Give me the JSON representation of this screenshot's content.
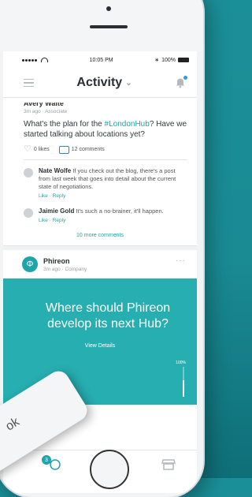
{
  "status_bar": {
    "time": "10:05 PM",
    "battery": "100%"
  },
  "nav": {
    "title": "Activity"
  },
  "post": {
    "author": "Avery Waite",
    "meta": "3m ago · Associate",
    "text_before": "What's the plan for the ",
    "hashtag": "#LondonHub",
    "text_after": "? Have we started talking about locations yet?",
    "likes": "0 likes",
    "comments": "12 comments"
  },
  "comments": [
    {
      "name": "Nate Wolfe",
      "text": "If you check out the blog, there's a post from last week that goes into detail about the current state of negotiations.",
      "links": "Like · Reply"
    },
    {
      "name": "Jaimie Gold",
      "text": "It's such a no-brainer, it'll happen.",
      "links": "Like · Reply"
    }
  ],
  "more_comments": "10 more comments",
  "company_post": {
    "name": "Phireon",
    "meta": "3m ago · Company",
    "logo_glyph": "Φ",
    "more": "···"
  },
  "promo": {
    "title": "Where should Phireon develop its next Hub?",
    "button": "View Details",
    "progress_label": "100%",
    "progress_fraction": 0.55,
    "color": "#27aeb1"
  },
  "tabbar": {
    "badge": "3"
  },
  "ok_button": {
    "label": "ok"
  },
  "colors": {
    "accent": "#1fa5a9",
    "background": "#1b8f98",
    "link": "#2a88c7"
  }
}
